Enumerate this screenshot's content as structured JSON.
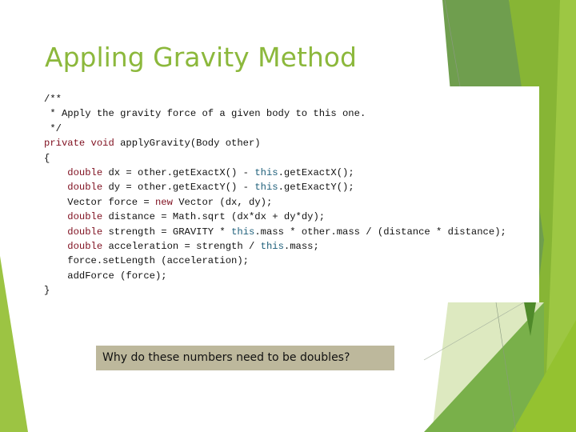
{
  "slide": {
    "title": "Appling Gravity Method",
    "colors": {
      "title": "#8cb83c",
      "keyword": "#7f0f1f",
      "this_keyword": "#1e5f7a",
      "question_bg": "#bdb89c"
    },
    "code": {
      "lines": [
        [
          {
            "t": "/**",
            "c": ""
          }
        ],
        [
          {
            "t": " * Apply the gravity force of a given body to this one.",
            "c": ""
          }
        ],
        [
          {
            "t": " */",
            "c": ""
          }
        ],
        [
          {
            "t": "private void",
            "c": "kw"
          },
          {
            "t": " applyGravity(Body other)",
            "c": ""
          }
        ],
        [
          {
            "t": "{",
            "c": ""
          }
        ],
        [
          {
            "t": "    ",
            "c": ""
          },
          {
            "t": "double",
            "c": "kw"
          },
          {
            "t": " dx = other.getExactX() - ",
            "c": ""
          },
          {
            "t": "this",
            "c": "th"
          },
          {
            "t": ".getExactX();",
            "c": ""
          }
        ],
        [
          {
            "t": "    ",
            "c": ""
          },
          {
            "t": "double",
            "c": "kw"
          },
          {
            "t": " dy = other.getExactY() - ",
            "c": ""
          },
          {
            "t": "this",
            "c": "th"
          },
          {
            "t": ".getExactY();",
            "c": ""
          }
        ],
        [
          {
            "t": "    Vector force = ",
            "c": ""
          },
          {
            "t": "new",
            "c": "kw"
          },
          {
            "t": " Vector (dx, dy);",
            "c": ""
          }
        ],
        [
          {
            "t": "    ",
            "c": ""
          },
          {
            "t": "double",
            "c": "kw"
          },
          {
            "t": " distance = Math.sqrt (dx*dx + dy*dy);",
            "c": ""
          }
        ],
        [
          {
            "t": "    ",
            "c": ""
          },
          {
            "t": "double",
            "c": "kw"
          },
          {
            "t": " strength = GRAVITY * ",
            "c": ""
          },
          {
            "t": "this",
            "c": "th"
          },
          {
            "t": ".mass * other.mass / (distance * distance);",
            "c": ""
          }
        ],
        [
          {
            "t": "    ",
            "c": ""
          },
          {
            "t": "double",
            "c": "kw"
          },
          {
            "t": " acceleration = strength / ",
            "c": ""
          },
          {
            "t": "this",
            "c": "th"
          },
          {
            "t": ".mass;",
            "c": ""
          }
        ],
        [
          {
            "t": "    force.setLength (acceleration);",
            "c": ""
          }
        ],
        [
          {
            "t": "    addForce (force);",
            "c": ""
          }
        ],
        [
          {
            "t": "}",
            "c": ""
          }
        ]
      ]
    },
    "question": "Why do these numbers need to be doubles?"
  }
}
